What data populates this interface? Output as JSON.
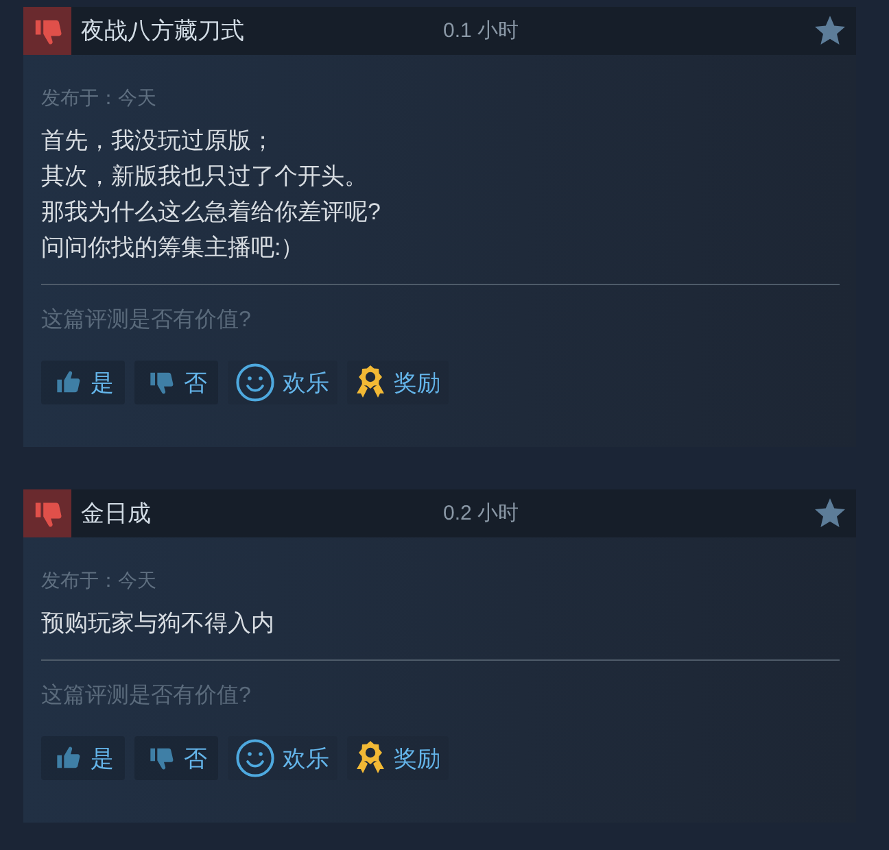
{
  "reviews": [
    {
      "recommended": false,
      "author": "夜战八方藏刀式",
      "hours": "0.1 小时",
      "posted": "发布于：今天",
      "body": [
        "首先，我没玩过原版；",
        "其次，新版我也只过了个开头。",
        "那我为什么这么急着给你差评呢?",
        "问问你找的筹集主播吧:）"
      ],
      "helpful_prompt": "这篇评测是否有价值?",
      "actions": [
        {
          "kind": "yes",
          "label": "是"
        },
        {
          "kind": "no",
          "label": "否"
        },
        {
          "kind": "funny",
          "label": "欢乐"
        },
        {
          "kind": "award",
          "label": "奖励"
        }
      ]
    },
    {
      "recommended": false,
      "author": "金日成",
      "hours": "0.2 小时",
      "posted": "发布于：今天",
      "body": [
        "预购玩家与狗不得入内"
      ],
      "helpful_prompt": "这篇评测是否有价值?",
      "actions": [
        {
          "kind": "yes",
          "label": "是"
        },
        {
          "kind": "no",
          "label": "否"
        },
        {
          "kind": "funny",
          "label": "欢乐"
        },
        {
          "kind": "award",
          "label": "奖励"
        }
      ]
    }
  ]
}
